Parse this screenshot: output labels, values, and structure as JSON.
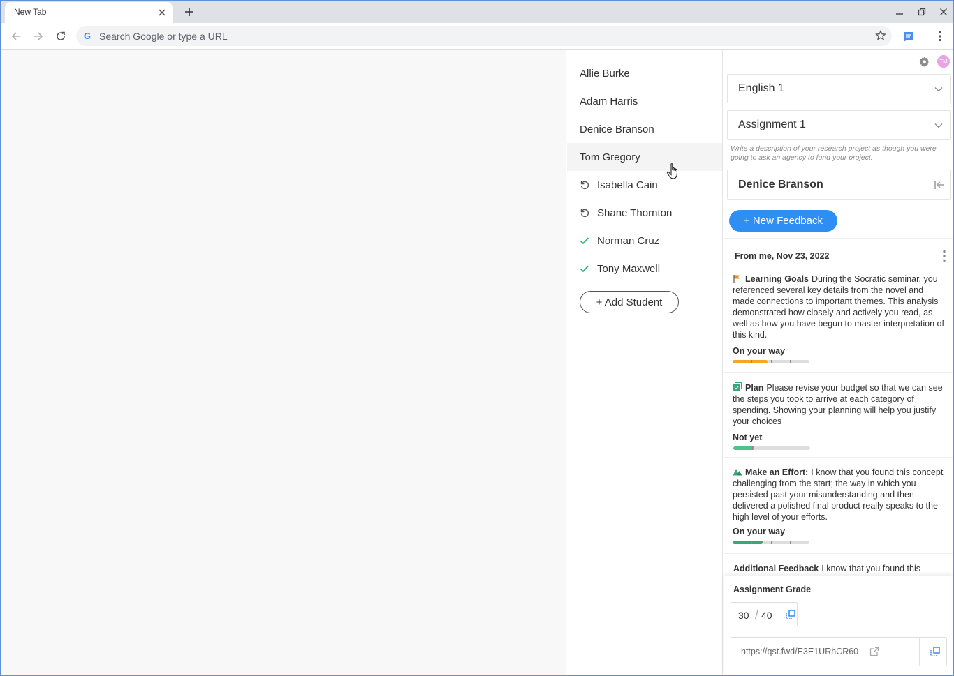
{
  "browser": {
    "tab_title": "New Tab",
    "omnibox_placeholder": "Search Google or type a URL",
    "google_letter": "G"
  },
  "students": [
    {
      "name": "Allie Burke",
      "status": "none"
    },
    {
      "name": "Adam Harris",
      "status": "none"
    },
    {
      "name": "Denice Branson",
      "status": "none"
    },
    {
      "name": "Tom Gregory",
      "status": "none",
      "hover": true
    },
    {
      "name": "Isabella Cain",
      "status": "returned"
    },
    {
      "name": "Shane Thornton",
      "status": "returned"
    },
    {
      "name": "Norman Cruz",
      "status": "done"
    },
    {
      "name": "Tony Maxwell",
      "status": "done"
    }
  ],
  "add_student_label": "+ Add Student",
  "panel": {
    "avatar_initials": "TM",
    "class_select": "English 1",
    "assignment_select": "Assignment 1",
    "assignment_description": "Write a description of your research project as though you were going to ask an agency to fund your project.",
    "selected_student": "Denice Branson",
    "new_feedback_label": "+ New Feedback",
    "feedback_date": "From me, Nov 23, 2022",
    "feedback": [
      {
        "category": "Learning Goals",
        "icon": "flag-icon",
        "text": "During the Socratic seminar, you referenced several key details from the novel and made connections to important themes. This analysis demonstrated how closely and actively you read, as well as how you have begun to master interpretation of this kind.",
        "level": "On your way",
        "progress": 0.45,
        "bar_color": "#f5a623"
      },
      {
        "category": "Plan",
        "icon": "checklist-icon",
        "text": "Please revise your budget so that we can see the steps you took to arrive at each category of spending. Showing your planning will help you justify your choices",
        "level": "Not yet",
        "progress": 0.27,
        "bar_color": "#4cc38a"
      },
      {
        "category": "Make an Effort:",
        "icon": "mountain-icon",
        "text": "I know that you found this concept challenging from the start; the way in which you persisted past your misunderstanding and then delivered a polished final product really speaks to the high level of your efforts.",
        "level": "On your way",
        "progress": 0.39,
        "bar_color": "#3aa676"
      },
      {
        "category": "Additional Feedback",
        "icon": "",
        "text": "I know that you found this concept challenging from the start; the way in which you persisted",
        "level": "",
        "progress": 0,
        "bar_color": ""
      }
    ],
    "grade_title": "Assignment Grade",
    "grade_score": "30",
    "grade_total": "40",
    "share_link": "https://qst.fwd/E3E1URhCR60"
  },
  "colors": {
    "accent_blue": "#2f8ef4",
    "check_green": "#2bb673",
    "flag_orange": "#f28c1e"
  }
}
